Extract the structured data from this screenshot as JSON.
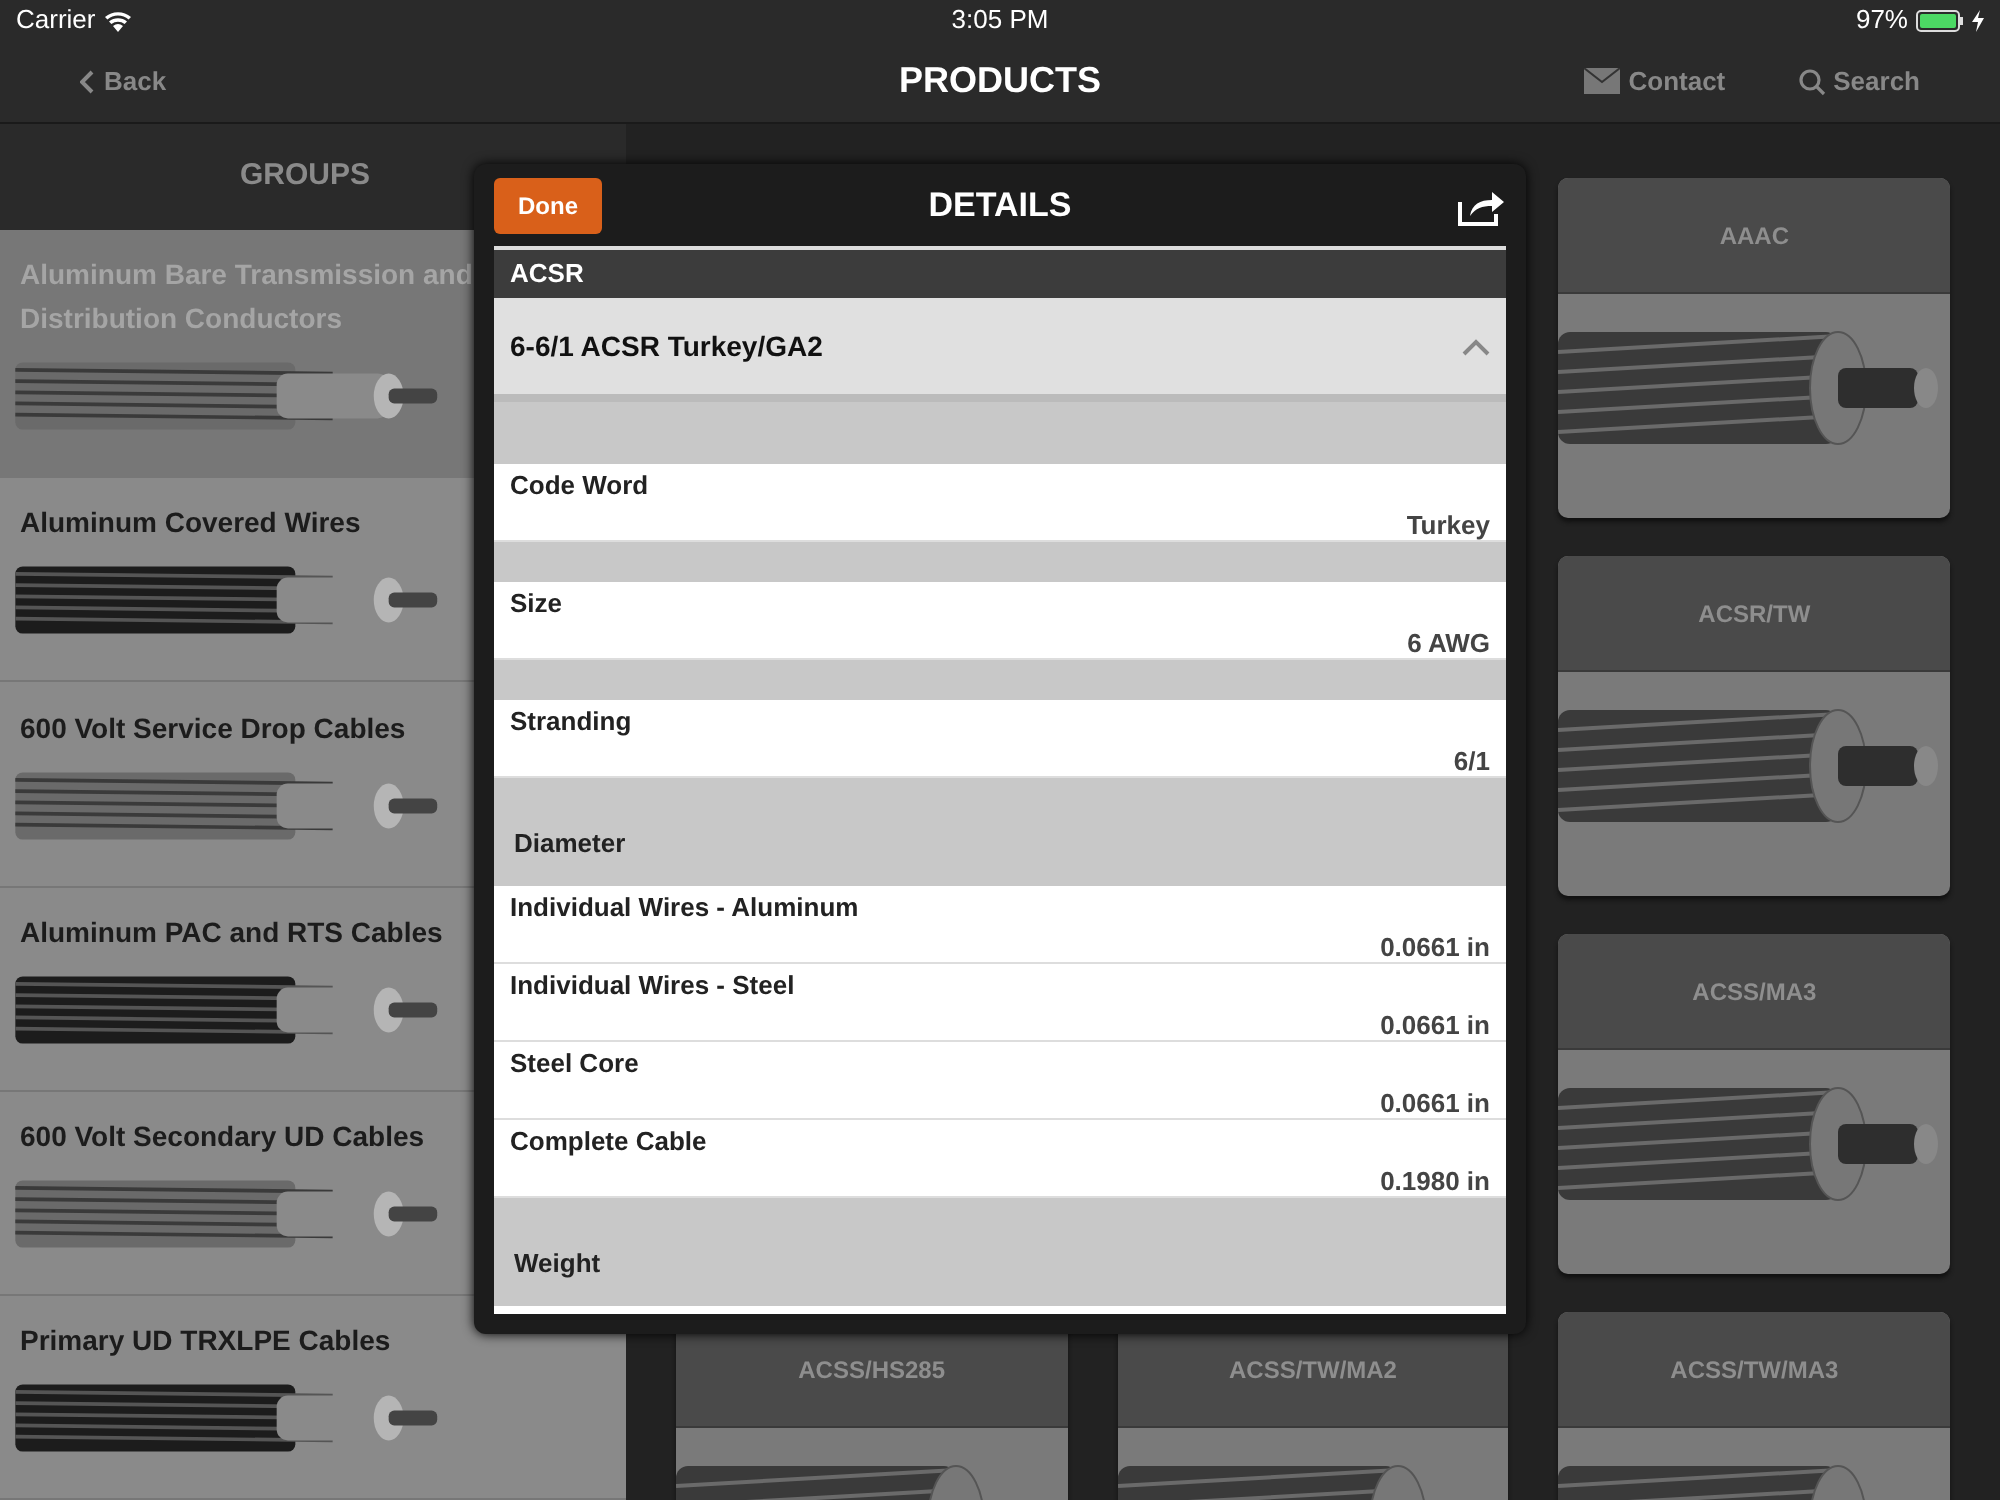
{
  "status_bar": {
    "carrier": "Carrier",
    "time": "3:05 PM",
    "battery": "97%",
    "charging": true
  },
  "nav": {
    "back": "Back",
    "title": "PRODUCTS",
    "actions": [
      "Contact",
      "Search"
    ]
  },
  "groups": {
    "title": "GROUPS",
    "items": [
      {
        "label": "Aluminum Bare Transmission and Distribution Conductors",
        "selected": true
      },
      {
        "label": "Aluminum Covered Wires",
        "selected": false
      },
      {
        "label": "600 Volt Service Drop Cables",
        "selected": false
      },
      {
        "label": "Aluminum PAC and RTS Cables",
        "selected": false
      },
      {
        "label": "600 Volt Secondary UD Cables",
        "selected": false
      },
      {
        "label": "Primary UD TRXLPE Cables",
        "selected": false
      }
    ]
  },
  "products": [
    "AAAC",
    "ACSR/TW",
    "ACSS/MA3",
    "ACSS/HS285",
    "ACSS/TW/MA2",
    "ACSS/TW/MA3"
  ],
  "details": {
    "done": "Done",
    "title": "DETAILS",
    "family": "ACSR",
    "product": "6-6/1 ACSR Turkey/GA2",
    "expanded": true,
    "rows": [
      {
        "kind": "spacer"
      },
      {
        "kind": "field",
        "label": "Code Word",
        "value": "Turkey"
      },
      {
        "kind": "spacer"
      },
      {
        "kind": "field",
        "label": "Size",
        "value": "6 AWG"
      },
      {
        "kind": "spacer"
      },
      {
        "kind": "field",
        "label": "Stranding",
        "value": "6/1"
      },
      {
        "kind": "section",
        "label": "Diameter"
      },
      {
        "kind": "field",
        "label": "Individual Wires - Aluminum",
        "value": "0.0661 in"
      },
      {
        "kind": "field",
        "label": "Individual Wires - Steel",
        "value": "0.0661 in"
      },
      {
        "kind": "field",
        "label": "Steel Core",
        "value": "0.0661 in"
      },
      {
        "kind": "field",
        "label": "Complete Cable",
        "value": "0.1980 in"
      },
      {
        "kind": "section",
        "label": "Weight"
      }
    ]
  }
}
